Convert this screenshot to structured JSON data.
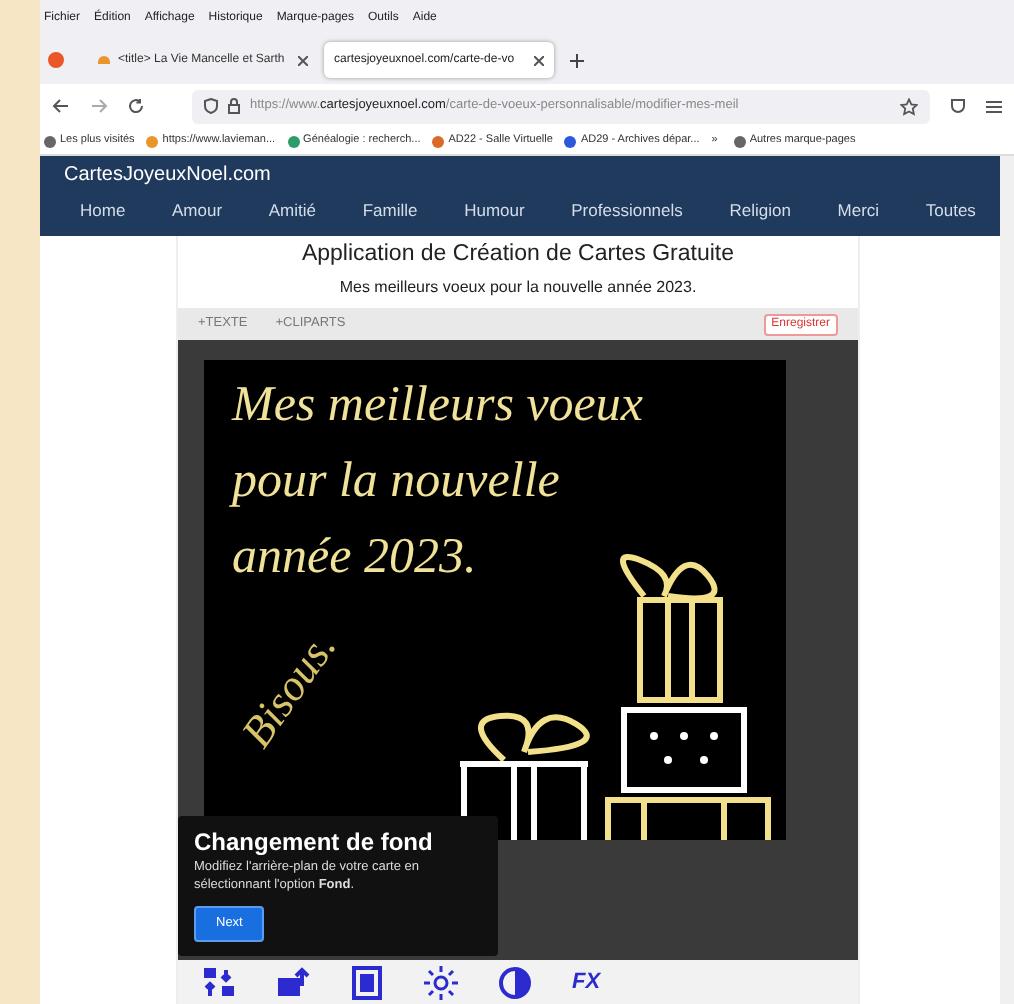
{
  "menu_bar": [
    "Fichier",
    "Édition",
    "Affichage",
    "Historique",
    "Marque-pages",
    "Outils",
    "Aide"
  ],
  "tabs": [
    {
      "label": "<title> La Vie Mancelle et Sarth",
      "selected": false
    },
    {
      "label": "cartesjoyeuxnoel.com/carte-de-vo",
      "selected": true
    }
  ],
  "address_bar": {
    "prefix": "https://www.",
    "domain": "cartesjoyeuxnoel.com",
    "path": "/carte-de-voeux-personnalisable/modifier-mes-meil"
  },
  "bookmarks": [
    "Les plus visités",
    "https://www.lavieman...",
    "Généalogie : recherch...",
    "AD22 - Salle Virtuelle",
    "AD29 - Archives dépar...",
    "»",
    "Autres marque-pages"
  ],
  "site": {
    "brand": "CartesJoyeuxNoel.com",
    "nav": [
      "Home",
      "Amour",
      "Amitié",
      "Famille",
      "Humour",
      "Professionnels",
      "Religion",
      "Merci",
      "Toutes"
    ]
  },
  "app": {
    "title": "Application de Création de Cartes Gratuite",
    "subtitle": "Mes meilleurs voeux pour la nouvelle année 2023.",
    "toolbar": [
      "+TEXTE",
      "+CLIPARTS"
    ],
    "save_button": "Enregistrer",
    "card": {
      "lines": [
        "Mes meilleurs voeux",
        "pour la nouvelle",
        "année 2023."
      ],
      "signature": "Bisous."
    },
    "tooltip": {
      "title": "Changement de fond",
      "body": "Modifiez l'arrière-plan de votre carte en sélectionnant l'option **Fond**.",
      "button": "Next"
    },
    "bottom_tools": [
      {
        "kind": "swap"
      },
      {
        "kind": "upload"
      },
      {
        "kind": "frame"
      },
      {
        "kind": "brightness"
      },
      {
        "kind": "contrast"
      },
      {
        "kind": "fx",
        "label": "FX"
      }
    ]
  }
}
